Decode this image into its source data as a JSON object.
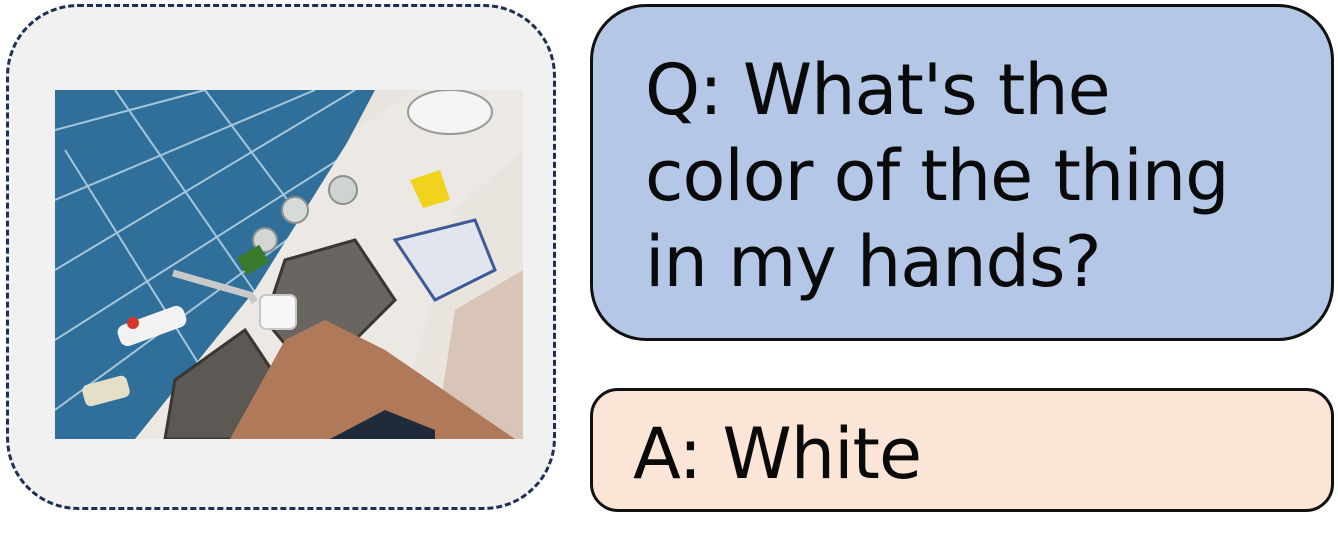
{
  "question": {
    "text": "Q: What's the\ncolor of the thing\nin my hands?"
  },
  "answer": {
    "text": "A: White"
  },
  "colors": {
    "image_panel_border": "#1e2f52",
    "image_panel_background": "#f1f1f1",
    "question_background": "#b4c7e7",
    "answer_background": "#fbe5d6",
    "bubble_border": "#111111"
  }
}
